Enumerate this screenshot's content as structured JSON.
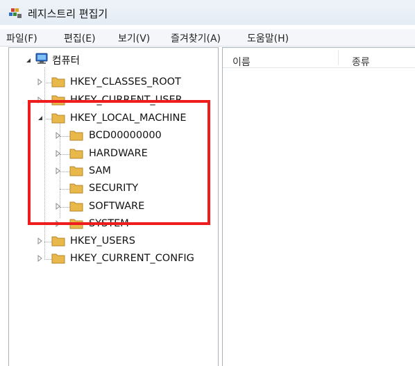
{
  "window": {
    "title": "레지스트리 편집기",
    "icon": "registry-editor-icon"
  },
  "menubar": {
    "items": [
      {
        "label": "파일(F)"
      },
      {
        "label": "편집(E)"
      },
      {
        "label": "보기(V)"
      },
      {
        "label": "즐겨찾기(A)"
      },
      {
        "label": "도움말(H)"
      }
    ]
  },
  "tree": {
    "root": {
      "label": "컴퓨터",
      "icon": "computer-icon",
      "expanded": true
    },
    "hives": [
      {
        "label": "HKEY_CLASSES_ROOT",
        "expanded": false
      },
      {
        "label": "HKEY_CURRENT_USER",
        "expanded": false
      },
      {
        "label": "HKEY_LOCAL_MACHINE",
        "expanded": true
      },
      {
        "label": "HKEY_USERS",
        "expanded": false
      },
      {
        "label": "HKEY_CURRENT_CONFIG",
        "expanded": false
      }
    ],
    "hklm_children": [
      {
        "label": "BCD00000000",
        "has_children": true
      },
      {
        "label": "HARDWARE",
        "has_children": true
      },
      {
        "label": "SAM",
        "has_children": true
      },
      {
        "label": "SECURITY",
        "has_children": false
      },
      {
        "label": "SOFTWARE",
        "has_children": true
      },
      {
        "label": "SYSTEM",
        "has_children": true
      }
    ]
  },
  "list": {
    "columns": [
      {
        "label": "이름"
      },
      {
        "label": "종류"
      }
    ]
  },
  "colors": {
    "highlight": "#ee1c1c",
    "folder": "#e8b84a",
    "titlebar": "#e8eff6"
  }
}
